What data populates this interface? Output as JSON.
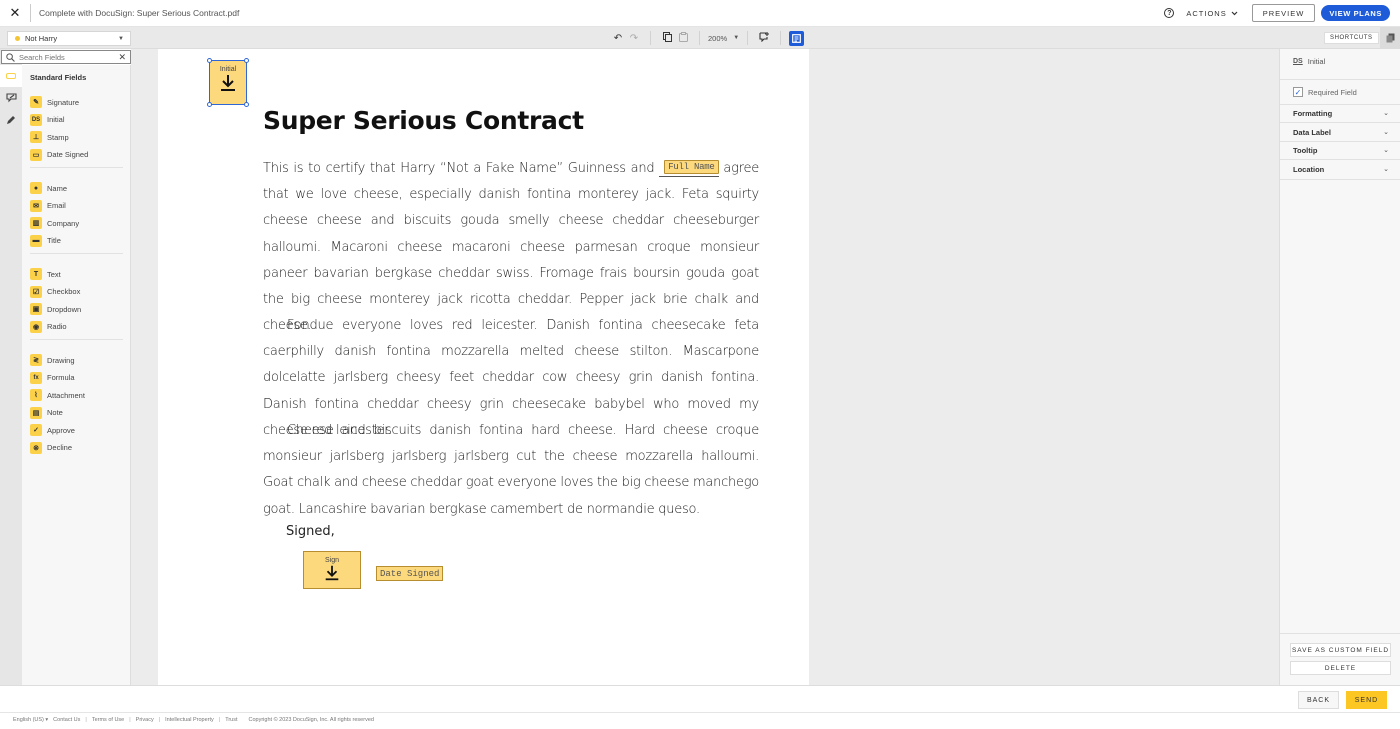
{
  "header": {
    "close_label": "✕",
    "title": "Complete with DocuSign: Super Serious Contract.pdf",
    "help_label": "?",
    "actions_label": "ACTIONS",
    "preview_label": "PREVIEW",
    "view_plans_label": "VIEW PLANS"
  },
  "toolbar": {
    "recipient": "Not Harry",
    "recipient_color": "#f5c431",
    "zoom_level": "200%",
    "shortcuts_label": "SHORTCUTS"
  },
  "sidebar": {
    "search_placeholder": "Search Fields",
    "section_title": "Standard Fields",
    "groups": [
      [
        {
          "label": "Signature",
          "icon": "signature-icon"
        },
        {
          "label": "Initial",
          "icon": "initial-icon"
        },
        {
          "label": "Stamp",
          "icon": "stamp-icon"
        },
        {
          "label": "Date Signed",
          "icon": "calendar-icon"
        }
      ],
      [
        {
          "label": "Name",
          "icon": "person-icon"
        },
        {
          "label": "Email",
          "icon": "envelope-icon"
        },
        {
          "label": "Company",
          "icon": "building-icon"
        },
        {
          "label": "Title",
          "icon": "briefcase-icon"
        }
      ],
      [
        {
          "label": "Text",
          "icon": "text-icon"
        },
        {
          "label": "Checkbox",
          "icon": "checkbox-icon"
        },
        {
          "label": "Dropdown",
          "icon": "dropdown-icon"
        },
        {
          "label": "Radio",
          "icon": "radio-icon"
        }
      ],
      [
        {
          "label": "Drawing",
          "icon": "drawing-icon"
        },
        {
          "label": "Formula",
          "icon": "formula-icon"
        },
        {
          "label": "Attachment",
          "icon": "paperclip-icon"
        },
        {
          "label": "Note",
          "icon": "note-icon"
        },
        {
          "label": "Approve",
          "icon": "approve-icon"
        },
        {
          "label": "Decline",
          "icon": "decline-icon"
        }
      ]
    ]
  },
  "document": {
    "title": "Super Serious Contract",
    "p1_before": "This is to certify that Harry “Not a Fake Name” Guinness and ",
    "full_name_tag": "Full Name",
    "p1_after": " agree that we love cheese, especially danish fontina monterey jack. Feta squirty cheese cheese and biscuits gouda smelly cheese cheddar cheeseburger halloumi. Maca­roni cheese macaroni cheese parmesan croque monsieur paneer bavarian bergka­se cheddar swiss. Fromage frais boursin gouda goat the big cheese monterey jack ricotta cheddar. Pepper jack brie chalk and cheese.",
    "p2": "Fondue everyone loves red leicester. Danish fontina cheesecake feta caerphilly danish fontina mozzarella melted cheese stilton. Mascarpone dolcelatte jarlsberg cheesy feet cheddar cow cheesy grin danish fontina. Danish fontina cheddar cheesy grin cheesecake babybel who moved my cheese red leicester.",
    "p3": "Cheese and biscuits danish fontina hard cheese. Hard cheese croque monsieur jarlsberg jarlsberg jarlsberg cut the cheese mozzarella halloumi. Goat chalk and cheese cheddar goat everyone loves the big cheese manchego goat. Lancashire bavarian bergkase camembert de normandie queso.",
    "signed_label": "Signed,",
    "initial_tag": "Initial",
    "sign_tag": "Sign",
    "date_signed_tag": "Date Signed"
  },
  "properties": {
    "field_type_badge": "DS",
    "field_type": "Initial",
    "required_label": "Required Field",
    "required_checked": true,
    "sections": [
      "Formatting",
      "Data Label",
      "Tooltip",
      "Location"
    ],
    "save_custom_label": "SAVE AS CUSTOM FIELD",
    "delete_label": "DELETE"
  },
  "footer_bar": {
    "back_label": "BACK",
    "send_label": "SEND"
  },
  "footer": {
    "language": "English (US)",
    "links": [
      "Contact Us",
      "Terms of Use",
      "Privacy",
      "Intellectual Property",
      "Trust"
    ],
    "copyright": "Copyright © 2023 DocuSign, Inc. All rights reserved"
  }
}
